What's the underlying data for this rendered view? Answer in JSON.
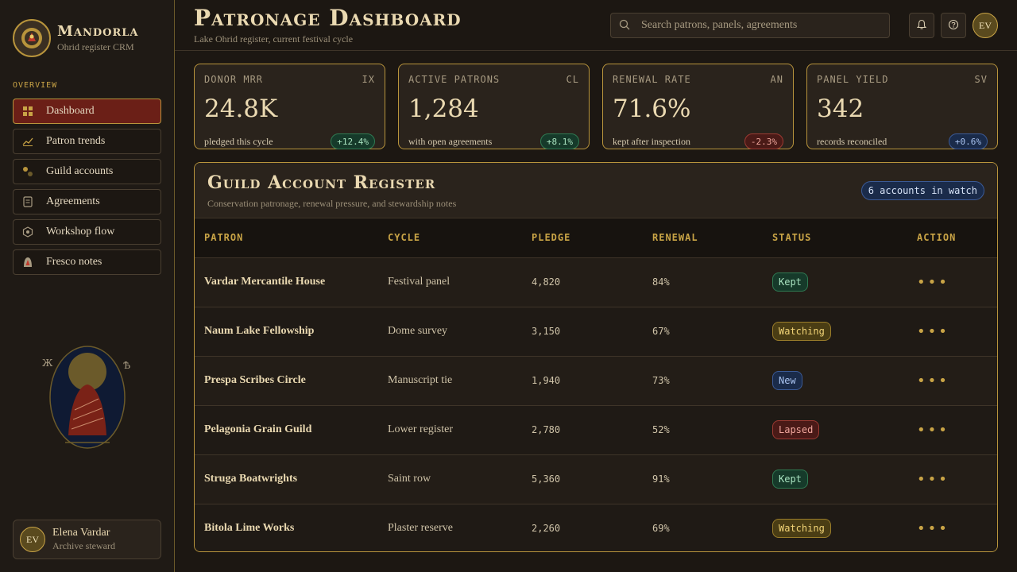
{
  "brand": {
    "name": "Mandorla",
    "subtitle": "Ohrid register CRM"
  },
  "nav": {
    "section": "OVERVIEW",
    "items": [
      {
        "label": "Dashboard",
        "icon": "grid-icon",
        "active": true
      },
      {
        "label": "Patron trends",
        "icon": "trend-icon"
      },
      {
        "label": "Guild accounts",
        "icon": "guild-icon"
      },
      {
        "label": "Agreements",
        "icon": "document-icon"
      },
      {
        "label": "Workshop flow",
        "icon": "hexagon-icon"
      },
      {
        "label": "Fresco notes",
        "icon": "fresco-icon"
      }
    ]
  },
  "icon_art": {
    "letter_left": "Ж",
    "letter_right": "Ѣ"
  },
  "user": {
    "initials": "EV",
    "name": "Elena Vardar",
    "role": "Archive steward"
  },
  "header": {
    "title": "Patronage Dashboard",
    "subtitle": "Lake Ohrid register, current festival cycle",
    "search_placeholder": "Search patrons, panels, agreements",
    "avatar_initials": "EV"
  },
  "kpis": [
    {
      "label": "DONOR MRR",
      "code": "IX",
      "value": "24.8K",
      "note": "pledged this cycle",
      "delta": "+12.4%",
      "tone": "up"
    },
    {
      "label": "ACTIVE PATRONS",
      "code": "CL",
      "value": "1,284",
      "note": "with open agreements",
      "delta": "+8.1%",
      "tone": "up"
    },
    {
      "label": "RENEWAL RATE",
      "code": "AN",
      "value": "71.6%",
      "note": "kept after inspection",
      "delta": "-2.3%",
      "tone": "down"
    },
    {
      "label": "PANEL YIELD",
      "code": "SV",
      "value": "342",
      "note": "records reconciled",
      "delta": "+0.6%",
      "tone": "info"
    }
  ],
  "register": {
    "title": "Guild Account Register",
    "subtitle": "Conservation patronage, renewal pressure, and stewardship notes",
    "badge": "6 accounts in watch",
    "columns": [
      "PATRON",
      "CYCLE",
      "PLEDGE",
      "RENEWAL",
      "STATUS",
      "ACTION"
    ],
    "rows": [
      {
        "patron": "Vardar Mercantile House",
        "cycle": "Festival panel",
        "pledge": "4,820",
        "renewal": "84%",
        "status": "Kept",
        "tone": "kept",
        "action": "•••"
      },
      {
        "patron": "Naum Lake Fellowship",
        "cycle": "Dome survey",
        "pledge": "3,150",
        "renewal": "67%",
        "status": "Watching",
        "tone": "watching",
        "action": "•••"
      },
      {
        "patron": "Prespa Scribes Circle",
        "cycle": "Manuscript tie",
        "pledge": "1,940",
        "renewal": "73%",
        "status": "New",
        "tone": "new",
        "action": "•••"
      },
      {
        "patron": "Pelagonia Grain Guild",
        "cycle": "Lower register",
        "pledge": "2,780",
        "renewal": "52%",
        "status": "Lapsed",
        "tone": "lapsed",
        "action": "•••"
      },
      {
        "patron": "Struga Boatwrights",
        "cycle": "Saint row",
        "pledge": "5,360",
        "renewal": "91%",
        "status": "Kept",
        "tone": "kept",
        "action": "•••"
      },
      {
        "patron": "Bitola Lime Works",
        "cycle": "Plaster reserve",
        "pledge": "2,260",
        "renewal": "69%",
        "status": "Watching",
        "tone": "watching",
        "action": "•••"
      }
    ]
  },
  "colors": {
    "gold": "#c9a446",
    "crimson": "#6b1f17",
    "ink": "#1c1712",
    "parchment": "#ead9b1"
  }
}
